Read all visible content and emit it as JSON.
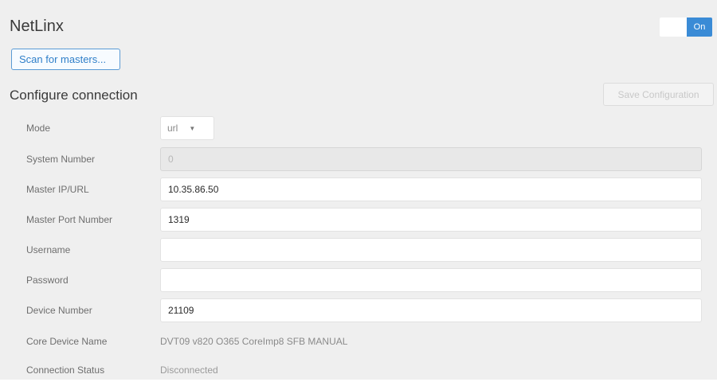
{
  "header": {
    "title": "NetLinx",
    "toggle_label": "On"
  },
  "scan_button": "Scan for masters...",
  "section": {
    "title": "Configure connection",
    "save_button": "Save Configuration"
  },
  "form": {
    "mode": {
      "label": "Mode",
      "value": "url"
    },
    "system_number": {
      "label": "System Number",
      "placeholder": "0"
    },
    "master_ip": {
      "label": "Master IP/URL",
      "value": "10.35.86.50"
    },
    "master_port": {
      "label": "Master Port Number",
      "value": "1319"
    },
    "username": {
      "label": "Username",
      "value": ""
    },
    "password": {
      "label": "Password",
      "value": ""
    },
    "device_number": {
      "label": "Device Number",
      "value": "21109"
    },
    "core_device_name": {
      "label": "Core Device Name",
      "value": "DVT09 v820 O365 CoreImp8 SFB MANUAL"
    },
    "connection_status": {
      "label": "Connection Status",
      "value": "Disconnected"
    }
  },
  "colors": {
    "accent": "#3a8bd6",
    "panel_background": "#efefef"
  }
}
